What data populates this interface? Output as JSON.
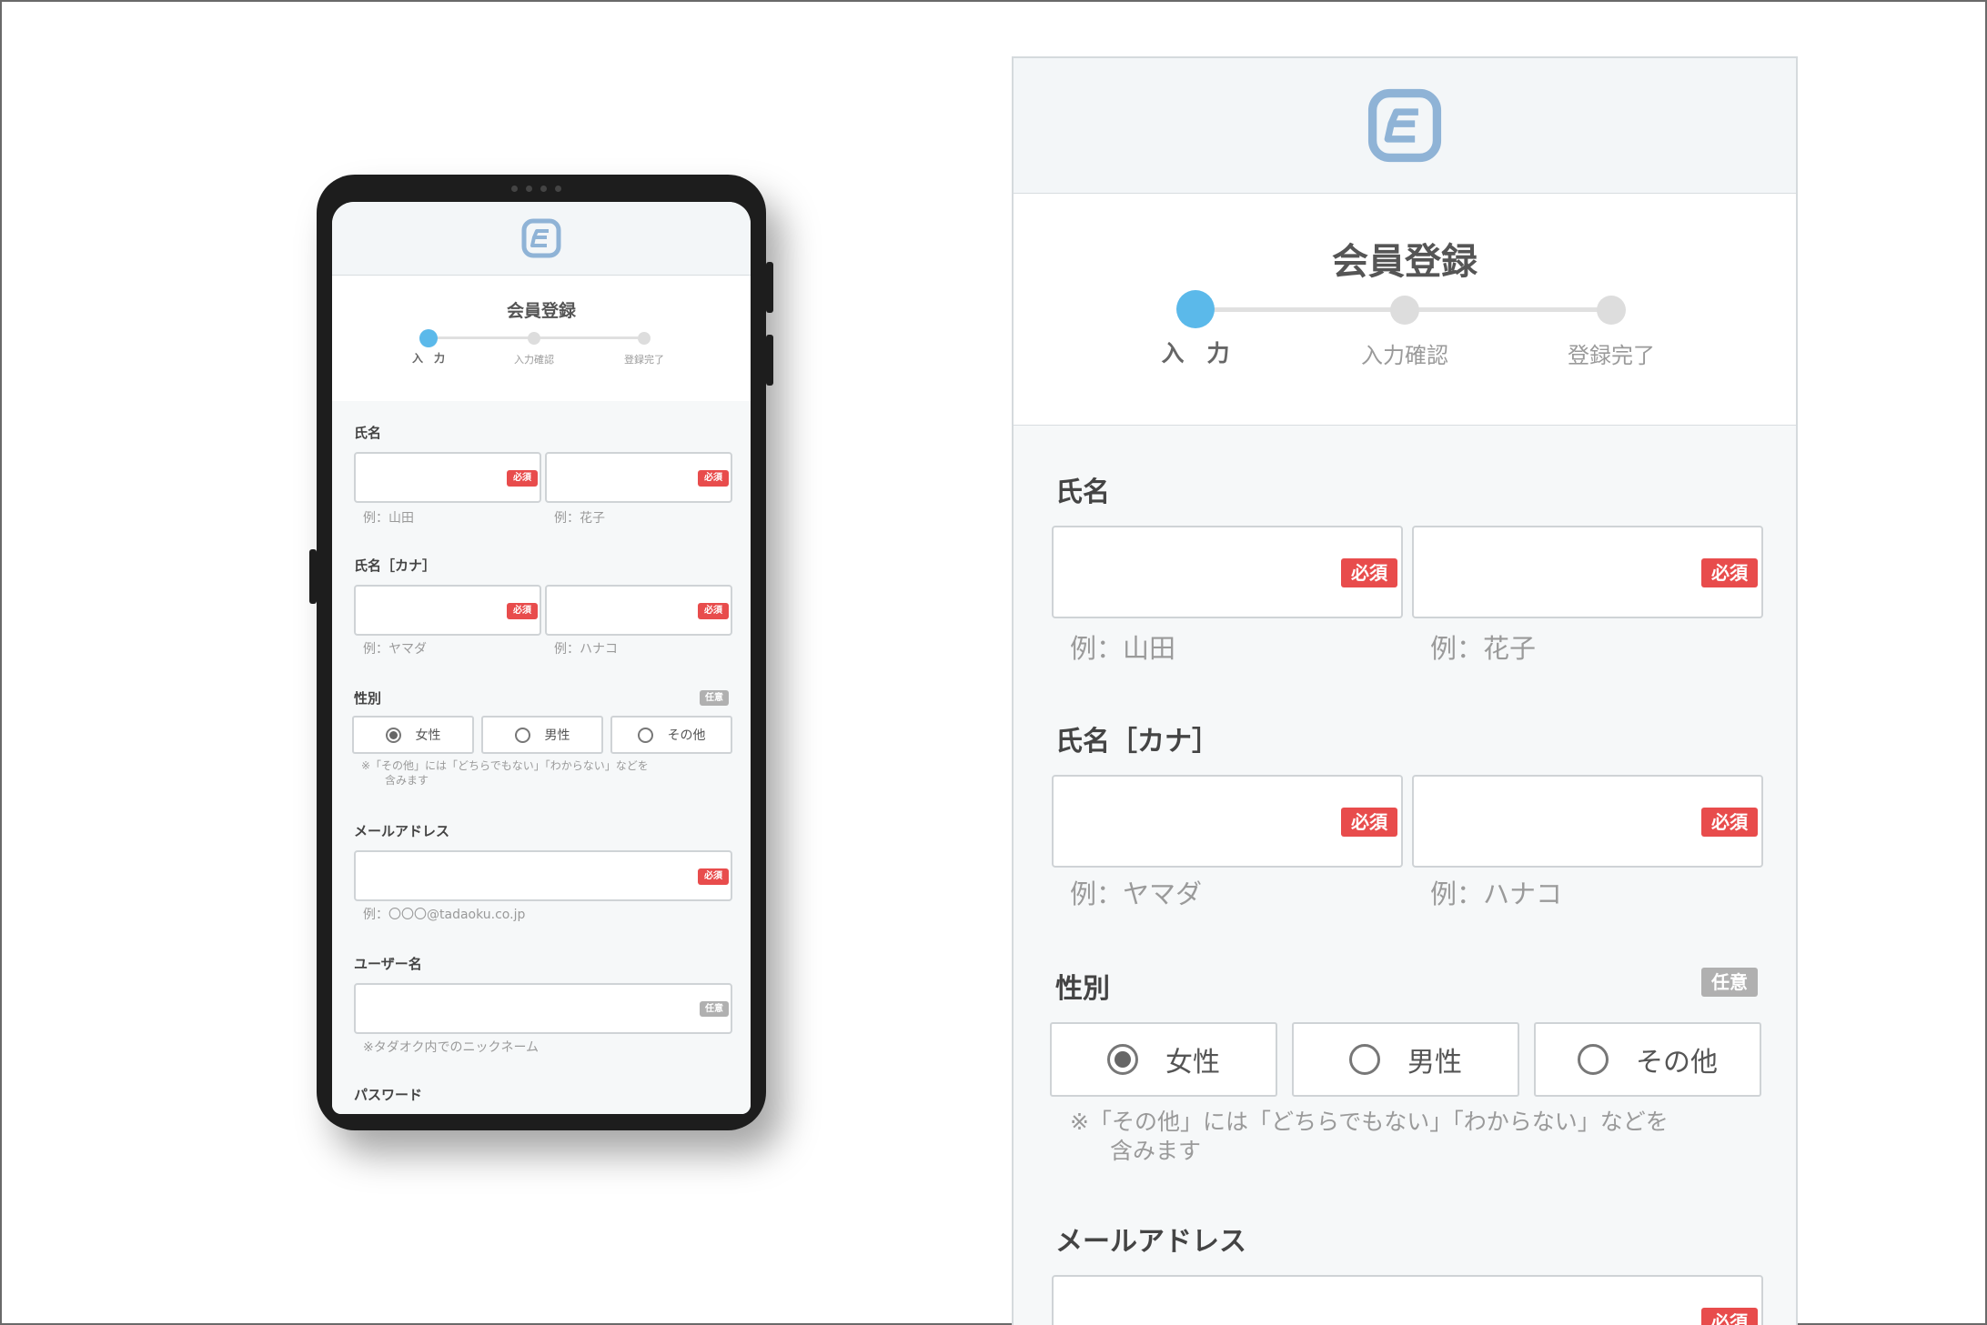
{
  "form": {
    "title": "会員登録",
    "steps": [
      "入　力",
      "入力確認",
      "登録完了"
    ],
    "required_tag": "必須",
    "optional_tag": "任意",
    "name": {
      "label": "氏名",
      "last_hint": "例：山田",
      "first_hint": "例：花子"
    },
    "kana": {
      "label": "氏名［カナ］",
      "last_hint": "例：ヤマダ",
      "first_hint": "例：ハナコ"
    },
    "gender": {
      "label": "性別",
      "options": [
        "女性",
        "男性",
        "その他"
      ],
      "selected": "女性",
      "note_line1": "※「その他」には「どちらでもない」「わからない」などを",
      "note_line2": "含みます"
    },
    "email": {
      "label": "メールアドレス",
      "hint": "例：〇〇〇@tadaoku.co.jp"
    },
    "username": {
      "label": "ユーザー名",
      "hint": "※タダオク内でのニックネーム"
    },
    "password": {
      "label": "パスワード"
    }
  },
  "colors": {
    "accent": "#5bb9ea",
    "required": "#e84c4c",
    "optional": "#b0b0b0",
    "logo": "#8fb3d6"
  },
  "icons": {
    "logo": "tadaoku-logo-icon"
  }
}
